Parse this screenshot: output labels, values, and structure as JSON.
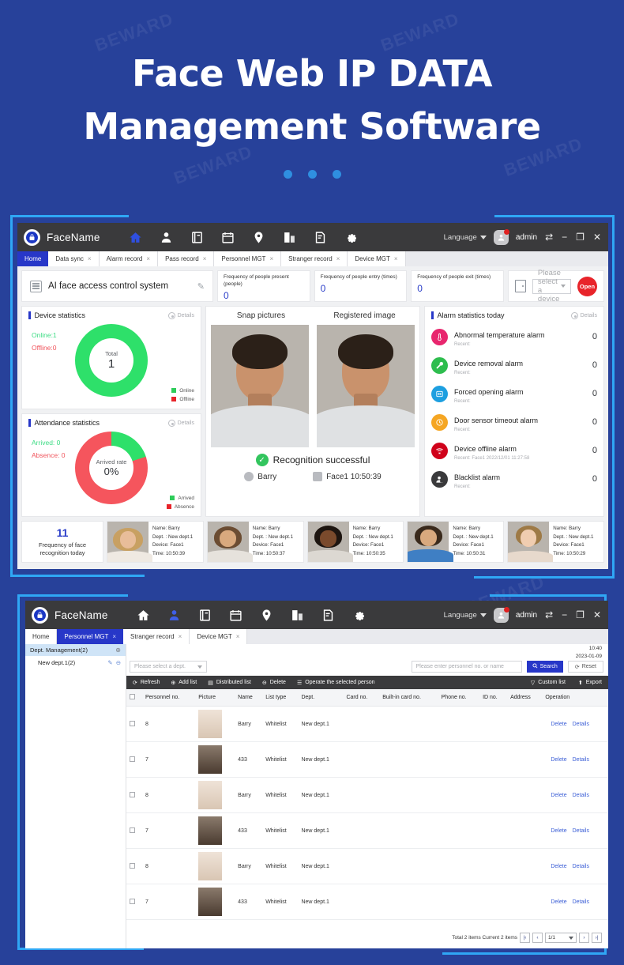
{
  "hero": {
    "line1": "Face Web IP DATA",
    "line2": "Management Software",
    "watermark": "BEWARD",
    "dots": 3
  },
  "colors": {
    "page_bg": "#27419a",
    "frame_accent": "#2fa7f5",
    "titlebar": "#3a3a3c",
    "primary": "#2737c8",
    "online_green": "#3ddc84",
    "offline_red": "#f0545c",
    "open_red": "#e8242a"
  },
  "window1": {
    "brand": "FaceName",
    "nav_icons": [
      "home-icon",
      "user-icon",
      "archive-icon",
      "calendar-icon",
      "location-icon",
      "door-lock-icon",
      "report-icon",
      "gear-icon"
    ],
    "language_label": "Language",
    "user_label": "admin",
    "window_buttons": [
      "switch-icon",
      "minimize-icon",
      "maximize-icon",
      "close-icon"
    ],
    "tabs": [
      {
        "label": "Home",
        "active": true,
        "closable": false
      },
      {
        "label": "Data sync",
        "active": false,
        "closable": true
      },
      {
        "label": "Alarm record",
        "active": false,
        "closable": true
      },
      {
        "label": "Pass record",
        "active": false,
        "closable": true
      },
      {
        "label": "Personnel MGT",
        "active": false,
        "closable": true
      },
      {
        "label": "Stranger record",
        "active": false,
        "closable": true
      },
      {
        "label": "Device MGT",
        "active": false,
        "closable": true
      }
    ],
    "system_title": "AI face access control system",
    "frequency_cards": [
      {
        "label": "Frequency of people present (people)",
        "value": "0"
      },
      {
        "label": "Frequency of people entry (times)",
        "value": "0"
      },
      {
        "label": "Frequency of people exit (times)",
        "value": "0"
      }
    ],
    "device_select_placeholder": "Please select a device",
    "open_button": "Open",
    "device_statistics": {
      "title": "Device statistics",
      "details": "Details",
      "online_label": "Online:1",
      "offline_label": "Offline:0",
      "center_label": "Total",
      "center_value": "1",
      "legend": [
        {
          "label": "Online",
          "color": "#2ecc5a"
        },
        {
          "label": "Offline",
          "color": "#e8242a"
        }
      ]
    },
    "attendance_statistics": {
      "title": "Attendance statistics",
      "details": "Details",
      "arrived_label": "Arrived: 0",
      "absence_label": "Absence: 0",
      "center_label": "Arrived rate",
      "center_value": "0%",
      "legend": [
        {
          "label": "Arrived",
          "color": "#2ecc5a"
        },
        {
          "label": "Absence",
          "color": "#e8242a"
        }
      ]
    },
    "snap": {
      "heading_left": "Snap pictures",
      "heading_right": "Registered image",
      "result": "Recognition successful",
      "person": "Barry",
      "device_time": "Face1 10:50:39"
    },
    "alarm_statistics": {
      "title": "Alarm statistics today",
      "details": "Details",
      "items": [
        {
          "name": "Abnormal temperature alarm",
          "recent": "Recent:",
          "count": "0",
          "color": "#e8266e",
          "icon": "thermometer-icon"
        },
        {
          "name": "Device removal alarm",
          "recent": "Recent:",
          "count": "0",
          "color": "#2ebd4e",
          "icon": "wrench-icon"
        },
        {
          "name": "Forced opening alarm",
          "recent": "Recent:",
          "count": "0",
          "color": "#1d9fe0",
          "icon": "forced-door-icon"
        },
        {
          "name": "Door sensor timeout alarm",
          "recent": "Recent:",
          "count": "0",
          "color": "#f5a623",
          "icon": "clock-icon"
        },
        {
          "name": "Device offline alarm",
          "recent": "Recent: Face1 2022/12/01 11:27:58",
          "count": "0",
          "color": "#d0021b",
          "icon": "wifi-off-icon"
        },
        {
          "name": "Blacklist alarm",
          "recent": "Recent:",
          "count": "0",
          "color": "#3a3a3c",
          "icon": "blacklist-user-icon"
        }
      ]
    },
    "filmstrip": {
      "count": "11",
      "caption": "Frequency of face recognition today",
      "items": [
        {
          "name": "Name: Barry",
          "dept": "Dept. : New dept.1",
          "device": "Device: Face1",
          "time": "Time: 10:50:39",
          "avatar": "woman-blonde"
        },
        {
          "name": "Name: Barry",
          "dept": "Dept. : New dept.1",
          "device": "Device: Face1",
          "time": "Time: 10:50:37",
          "avatar": "man-beard"
        },
        {
          "name": "Name: Barry",
          "dept": "Dept. : New dept.1",
          "device": "Device: Face1",
          "time": "Time: 10:50:35",
          "avatar": "woman-dark"
        },
        {
          "name": "Name: Barry",
          "dept": "Dept. : New dept.1",
          "device": "Device: Face1",
          "time": "Time: 10:50:31",
          "avatar": "man-blue"
        },
        {
          "name": "Name: Barry",
          "dept": "Dept. : New dept.1",
          "device": "Device: Face1",
          "time": "Time: 10:50:29",
          "avatar": "woman-pale"
        }
      ]
    }
  },
  "window2": {
    "brand": "FaceName",
    "nav_icons": [
      "home-icon",
      "user-icon",
      "archive-icon",
      "calendar-icon",
      "location-icon",
      "door-lock-icon",
      "report-icon",
      "gear-icon"
    ],
    "language_label": "Language",
    "user_label": "admin",
    "tabs": [
      {
        "label": "Home",
        "active": false,
        "closable": false
      },
      {
        "label": "Personnel MGT",
        "active": true,
        "closable": true
      },
      {
        "label": "Stranger record",
        "active": false,
        "closable": true
      },
      {
        "label": "Device MGT",
        "active": false,
        "closable": true
      }
    ],
    "clock": {
      "time": "10:40",
      "date": "2023-01-09"
    },
    "sidebar": {
      "root": "Dept. Management(2)",
      "items": [
        {
          "label": "New dept.1(2)"
        }
      ]
    },
    "dept_select_placeholder": "Please select a dept.",
    "search_placeholder": "Please enter personnel no. or name",
    "search_button": "Search",
    "reset_button": "Reset",
    "actions": [
      "Refresh",
      "Add list",
      "Distributed list",
      "Delete",
      "Operate the selected person"
    ],
    "actions_right": [
      "Custom list",
      "Export"
    ],
    "table": {
      "columns": [
        "Personnel no.",
        "Picture",
        "Name",
        "List type",
        "Dept.",
        "Card no.",
        "Built-in card no.",
        "Phone no.",
        "ID no.",
        "Address",
        "Operation"
      ],
      "rows": [
        {
          "no": "8",
          "avatar": "woman-pale",
          "name": "Barry",
          "list_type": "Whitelist",
          "dept": "New dept.1",
          "card_no": "",
          "builtin_card_no": "",
          "phone_no": "",
          "id_no": "",
          "address": "",
          "ops": [
            "Delete",
            "Details"
          ]
        },
        {
          "no": "7",
          "avatar": "man-dark",
          "name": "433",
          "list_type": "Whitelist",
          "dept": "New dept.1",
          "card_no": "",
          "builtin_card_no": "",
          "phone_no": "",
          "id_no": "",
          "address": "",
          "ops": [
            "Delete",
            "Details"
          ]
        },
        {
          "no": "8",
          "avatar": "woman-pale",
          "name": "Barry",
          "list_type": "Whitelist",
          "dept": "New dept.1",
          "card_no": "",
          "builtin_card_no": "",
          "phone_no": "",
          "id_no": "",
          "address": "",
          "ops": [
            "Delete",
            "Details"
          ]
        },
        {
          "no": "7",
          "avatar": "man-dark",
          "name": "433",
          "list_type": "Whitelist",
          "dept": "New dept.1",
          "card_no": "",
          "builtin_card_no": "",
          "phone_no": "",
          "id_no": "",
          "address": "",
          "ops": [
            "Delete",
            "Details"
          ]
        },
        {
          "no": "8",
          "avatar": "woman-pale",
          "name": "Barry",
          "list_type": "Whitelist",
          "dept": "New dept.1",
          "card_no": "",
          "builtin_card_no": "",
          "phone_no": "",
          "id_no": "",
          "address": "",
          "ops": [
            "Delete",
            "Details"
          ]
        },
        {
          "no": "7",
          "avatar": "man-dark",
          "name": "433",
          "list_type": "Whitelist",
          "dept": "New dept.1",
          "card_no": "",
          "builtin_card_no": "",
          "phone_no": "",
          "id_no": "",
          "address": "",
          "ops": [
            "Delete",
            "Details"
          ]
        }
      ]
    },
    "pager": {
      "summary": "Total 2 items Current 2 items",
      "page": "1/1"
    }
  }
}
